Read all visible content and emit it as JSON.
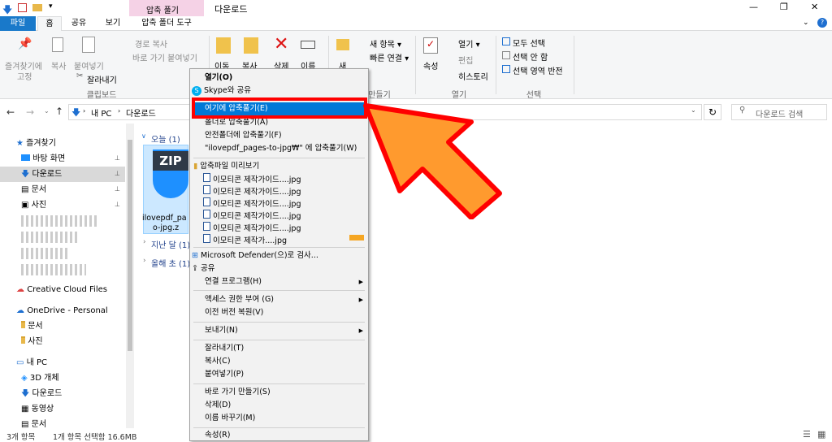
{
  "window": {
    "title": "다운로드",
    "ribbon_context": "압축 풀기",
    "minimize": "—",
    "maximize": "❐",
    "close": "✕"
  },
  "tabs": {
    "file": "파일",
    "home": "홈",
    "share": "공유",
    "view": "보기",
    "tool": "압축 폴더 도구"
  },
  "ribbon": {
    "pin": "즐겨찾기에\n고정",
    "pin1": "즐겨찾기에",
    "pin2": "고정",
    "copy": "복사",
    "paste": "붙여넣기",
    "copy_path": "경로 복사",
    "paste_shortcut": "바로 가기 붙여넣기",
    "cut": "잘라내기",
    "clipboard": "클립보드",
    "move": "이동",
    "copy2": "복사",
    "delete": "삭제",
    "rename": "이름",
    "new": "새",
    "new_item": "새 항목 ▾",
    "easy_access": "빠른 연결 ▾",
    "new_group": "만들기",
    "properties": "속성",
    "open": "열기 ▾",
    "edit": "편집",
    "history": "히스토리",
    "open_group": "열기",
    "select_all": "모두 선택",
    "select_none": "선택 안 함",
    "invert": "선택 영역 반전",
    "select_group": "선택"
  },
  "address": {
    "path_root": "내 PC",
    "path_folder": "다운로드",
    "search_placeholder": "다운로드 검색"
  },
  "nav": {
    "quick": "즐겨찾기",
    "desktop": "바탕 화면",
    "downloads": "다운로드",
    "docs": "문서",
    "pics": "사진",
    "cc": "Creative Cloud Files",
    "onedrive": "OneDrive - Personal",
    "od_docs": "문서",
    "od_pics": "사진",
    "pc": "내 PC",
    "obj3d": "3D 개체",
    "pc_down": "다운로드",
    "video": "동영상",
    "pc_docs": "문서"
  },
  "content": {
    "today": "오늘 (1)",
    "lastmonth": "지난 달 (1)",
    "earlier": "올해 초 (1)",
    "file1": "ilovepdf_pa",
    "file2": "o-jpg.z",
    "zip": "ZIP"
  },
  "status": {
    "count": "3개 항목",
    "selected": "1개 항목 선택함 16.6MB"
  },
  "menu": {
    "open": "열기(O)",
    "skype": "Skype와 공유",
    "extract_here": "여기에 압축풀기(E)",
    "extract_to": "폴더로 압축풀기(A)",
    "safe_extract": "안전폴더에 압축풀기(F)",
    "extract_named": "\"ilovepdf_pages-to-jpg₩\" 에 압축풀기(W)",
    "preview": "압축파일 미리보기",
    "img1": "이모티콘 제작가이드....jpg",
    "img2": "이모티콘 제작가이드....jpg",
    "img3": "이모티콘 제작가이드....jpg",
    "img4": "이모티콘 제작가이드....jpg",
    "img5": "이모티콘 제작가이드....jpg",
    "img6": "이모티콘 제작가....jpg",
    "defender": "Microsoft Defender(으)로 검사...",
    "share": "공유",
    "open_with": "연결 프로그램(H)",
    "access": "액세스 권한 부여 (G)",
    "restore": "이전 버전 복원(V)",
    "sendto": "보내기(N)",
    "cut": "잘라내기(T)",
    "copy": "복사(C)",
    "paste": "붙여넣기(P)",
    "shortcut": "바로 가기 만들기(S)",
    "del": "삭제(D)",
    "rename": "이름 바꾸기(M)",
    "props": "속성(R)"
  },
  "colors": {
    "accent": "#0078d7",
    "highlight": "#ff0000",
    "callout": "#ff9a2e",
    "ribbon_tab": "#e9a0c8"
  }
}
